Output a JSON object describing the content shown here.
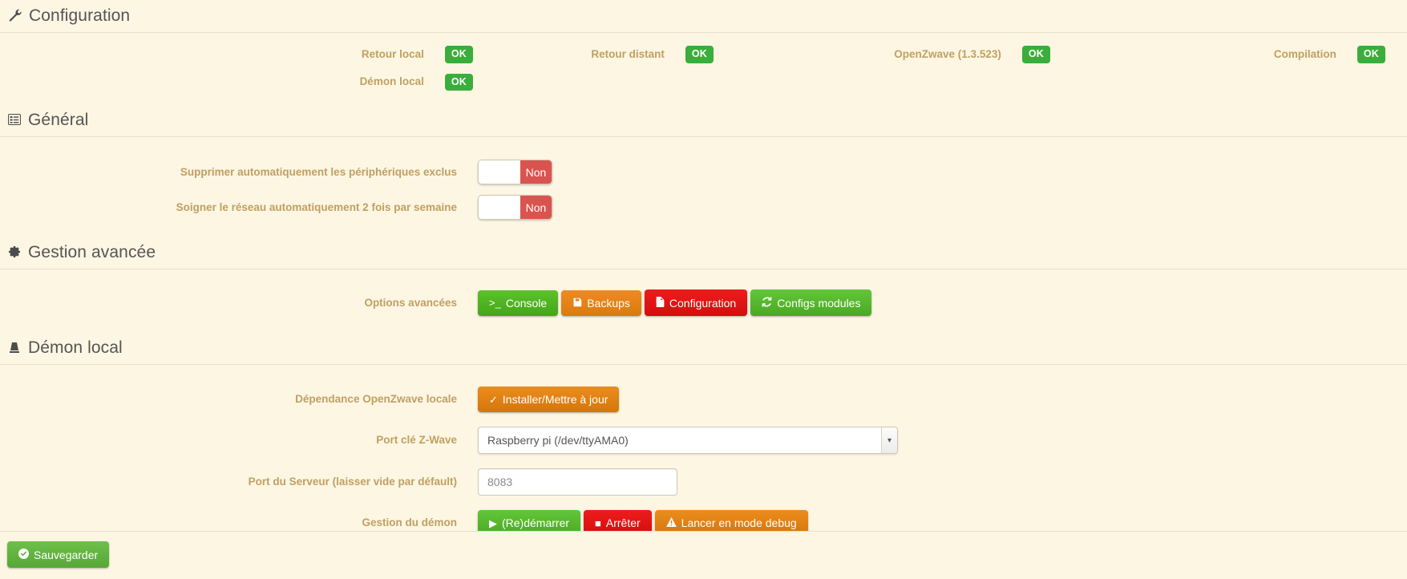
{
  "page": {
    "title": "Configuration",
    "title_icon": "wrench-icon"
  },
  "status": {
    "items": [
      {
        "label": "Retour local",
        "badge": "OK",
        "badge_color": "#3aae3a"
      },
      {
        "label": "Retour distant",
        "badge": "OK",
        "badge_color": "#3aae3a"
      },
      {
        "label": "OpenZwave (1.3.523)",
        "badge": "OK",
        "badge_color": "#3aae3a"
      },
      {
        "label": "Compilation",
        "badge": "OK",
        "badge_color": "#3aae3a"
      },
      {
        "label": "Démon local",
        "badge": "OK",
        "badge_color": "#3aae3a"
      }
    ]
  },
  "general": {
    "legend": "Général",
    "legend_icon": "list-icon",
    "rows": [
      {
        "label": "Supprimer automatiquement les périphériques exclus",
        "toggle_value": "Non",
        "toggle_color": "#d9534f"
      },
      {
        "label": "Soigner le réseau automatiquement 2 fois par semaine",
        "toggle_value": "Non",
        "toggle_color": "#d9534f"
      }
    ]
  },
  "advanced": {
    "legend": "Gestion avancée",
    "legend_icon": "gear-icon",
    "row_label": "Options avancées",
    "buttons": [
      {
        "label": "Console",
        "icon": "terminal-icon",
        "color": "green"
      },
      {
        "label": "Backups",
        "icon": "save-icon",
        "color": "orange"
      },
      {
        "label": "Configuration",
        "icon": "file-icon",
        "color": "red"
      },
      {
        "label": "Configs modules",
        "icon": "refresh-icon",
        "color": "green"
      }
    ]
  },
  "daemon": {
    "legend": "Démon local",
    "legend_icon": "chip-icon",
    "dependency_label": "Dépendance OpenZwave locale",
    "dependency_button": {
      "label": "Installer/Mettre à jour",
      "icon": "check-icon",
      "color": "darkorange"
    },
    "port_key_label": "Port clé Z-Wave",
    "port_key_value": "Raspberry pi (/dev/ttyAMA0)",
    "port_key_caret": "chevron-down-icon",
    "server_port_label": "Port du Serveur (laisser vide par défault)",
    "server_port_placeholder": "8083",
    "server_port_value": "",
    "management_label": "Gestion du démon",
    "management_buttons": [
      {
        "label": "(Re)démarrer",
        "icon": "play-icon",
        "color": "brightgreen"
      },
      {
        "label": "Arrêter",
        "icon": "stop-icon",
        "color": "red"
      },
      {
        "label": "Lancer en mode debug",
        "icon": "warning-icon",
        "color": "darkorange"
      }
    ]
  },
  "footer": {
    "save_label": "Sauvegarder",
    "save_icon": "check-circle-icon"
  }
}
